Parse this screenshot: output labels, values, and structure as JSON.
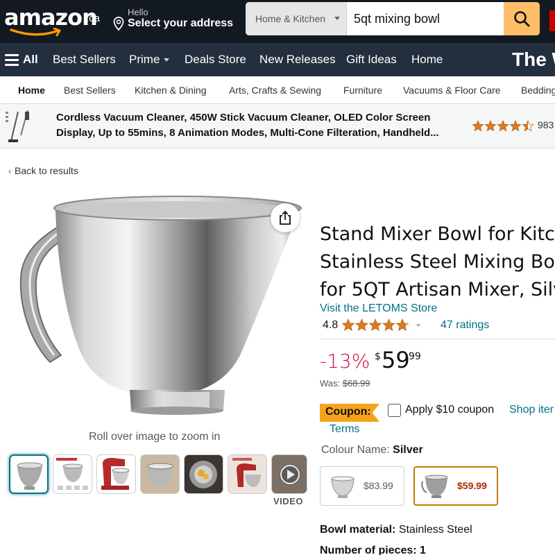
{
  "header": {
    "logo_text": "amazon",
    "logo_suffix": ".ca",
    "address_hello": "Hello",
    "address_main": "Select your address",
    "search_category": "Home & Kitchen",
    "search_value": "5qt mixing bowl"
  },
  "nav": {
    "all_label": "All",
    "items": [
      "Best Sellers",
      "Prime",
      "Deals Store",
      "New Releases",
      "Gift Ideas",
      "Home"
    ],
    "promo_text": "The W"
  },
  "subnav": {
    "items": [
      "Home",
      "Best Sellers",
      "Kitchen & Dining",
      "Arts, Crafts & Sewing",
      "Furniture",
      "Vacuums & Floor Care",
      "Bedding"
    ]
  },
  "sponsored": {
    "line1": "Cordless Vacuum Cleaner, 450W Stick Vacuum Cleaner, OLED Color Screen",
    "line2": "Display, Up to 55mins, 8 Animation Modes, Multi-Cone Filteration, Handheld...",
    "rating_stars": 4.5,
    "rating_count": "983"
  },
  "breadcrumb": {
    "back_label": "Back to results"
  },
  "gallery": {
    "zoom_hint": "Roll over image to zoom in",
    "video_label": "VIDEO",
    "thumbnail_count": 7,
    "selected_index": 0
  },
  "product": {
    "title_lines": [
      "Stand Mixer Bowl  for Kitc",
      "Stainless Steel Mixing Bow",
      "for 5QT Artisan Mixer, Silv"
    ],
    "store_link": "Visit the LETOMS Store",
    "rating_value": "4.8",
    "rating_stars": 4.8,
    "ratings_count": "47 ratings",
    "discount": "-13%",
    "price_symbol": "$",
    "price_whole": "59",
    "price_fraction": "99",
    "was_label": "Was: ",
    "was_price": "$68.99",
    "coupon_label": "Coupon:",
    "coupon_apply": "Apply $10 coupon",
    "coupon_shop": "Shop iter",
    "terms": "Terms",
    "colour_label": "Colour Name: ",
    "colour_value": "Silver",
    "swatches": [
      {
        "price": "$83.99",
        "selected": false
      },
      {
        "price": "$59.99",
        "selected": true
      }
    ],
    "spec_label": "Bowl material: ",
    "spec_value": "Stainless Steel",
    "spec_next_label": "Number of pieces: 1"
  },
  "colors": {
    "header_bg": "#131921",
    "nav_bg": "#232f3e",
    "search_button": "#febd69",
    "link": "#007185",
    "discount": "#cc0c39",
    "star": "#de7921",
    "coupon": "#f6a31a"
  },
  "icons": {
    "share": "share-icon",
    "search": "search-icon",
    "location": "location-pin-icon",
    "menu": "hamburger-menu-icon",
    "play": "play-icon"
  }
}
